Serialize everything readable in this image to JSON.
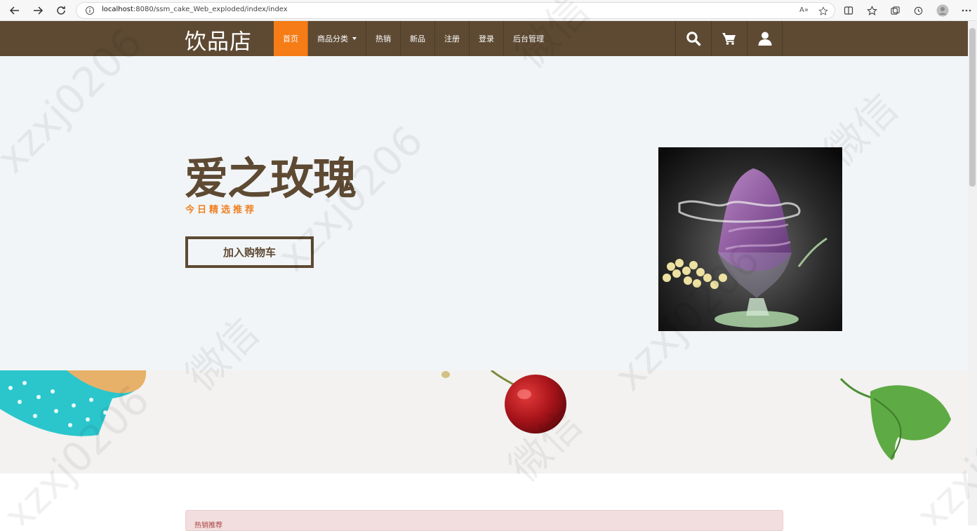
{
  "browser": {
    "url_host": "localhost",
    "url_rest": ":8080/ssm_cake_Web_exploded/index/index",
    "read_aloud": "A»"
  },
  "site": {
    "logo": "饮品店",
    "nav": {
      "home": "首页",
      "categories": "商品分类",
      "hot": "热销",
      "new": "新品",
      "register": "注册",
      "login": "登录",
      "admin": "后台管理"
    }
  },
  "hero": {
    "title": "爱之玫瑰",
    "subtitle": "今日精选推荐",
    "cta": "加入购物车"
  },
  "hot_section": {
    "heading": "热销推荐"
  },
  "watermark": {
    "texts": [
      "微信",
      "xzxj0206"
    ]
  },
  "colors": {
    "nav_bg": "#5e4a33",
    "accent": "#f57c16",
    "hero_bg": "#f2f5f7"
  }
}
